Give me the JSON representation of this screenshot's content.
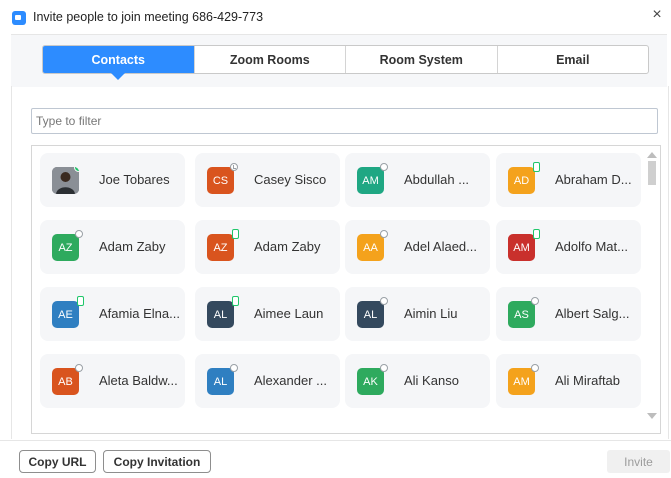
{
  "window": {
    "title": "Invite people to join meeting 686-429-773",
    "close_icon": "×"
  },
  "tabs": [
    {
      "label": "Contacts",
      "active": true
    },
    {
      "label": "Zoom Rooms",
      "active": false
    },
    {
      "label": "Room System",
      "active": false
    },
    {
      "label": "Email",
      "active": false
    }
  ],
  "filter": {
    "placeholder": "Type to filter",
    "value": ""
  },
  "contacts": [
    {
      "name": "Joe Tobares",
      "initials": "",
      "photo": true,
      "color": "#6b6e73",
      "status": "online"
    },
    {
      "name": "Casey Sisco",
      "initials": "CS",
      "color": "#d9541e",
      "status": "away"
    },
    {
      "name": "Abdullah ...",
      "initials": "AM",
      "color": "#1fa783",
      "status": "offline"
    },
    {
      "name": "Abraham D...",
      "initials": "AD",
      "color": "#f4a21c",
      "status": "phone"
    },
    {
      "name": "Adam Zaby",
      "initials": "AZ",
      "color": "#2eaa5e",
      "status": "offline"
    },
    {
      "name": "Adam Zaby",
      "initials": "AZ",
      "color": "#d9541e",
      "status": "phone"
    },
    {
      "name": "Adel Alaed...",
      "initials": "AA",
      "color": "#f4a21c",
      "status": "offline"
    },
    {
      "name": "Adolfo Mat...",
      "initials": "AM",
      "color": "#c9302c",
      "status": "phone"
    },
    {
      "name": "Afamia Elna...",
      "initials": "AE",
      "color": "#2f7fc1",
      "status": "phone"
    },
    {
      "name": "Aimee Laun",
      "initials": "AL",
      "color": "#34495e",
      "status": "phone"
    },
    {
      "name": "Aimin Liu",
      "initials": "AL",
      "color": "#34495e",
      "status": "offline"
    },
    {
      "name": "Albert Salg...",
      "initials": "AS",
      "color": "#2eaa5e",
      "status": "offline"
    },
    {
      "name": "Aleta Baldw...",
      "initials": "AB",
      "color": "#d9541e",
      "status": "offline"
    },
    {
      "name": "Alexander ...",
      "initials": "AL",
      "color": "#2f7fc1",
      "status": "offline"
    },
    {
      "name": "Ali Kanso",
      "initials": "AK",
      "color": "#2eaa5e",
      "status": "offline"
    },
    {
      "name": "Ali Miraftab",
      "initials": "AM",
      "color": "#f4a21c",
      "status": "offline"
    }
  ],
  "footer": {
    "copy_url": "Copy URL",
    "copy_invitation": "Copy Invitation",
    "invite": "Invite"
  }
}
